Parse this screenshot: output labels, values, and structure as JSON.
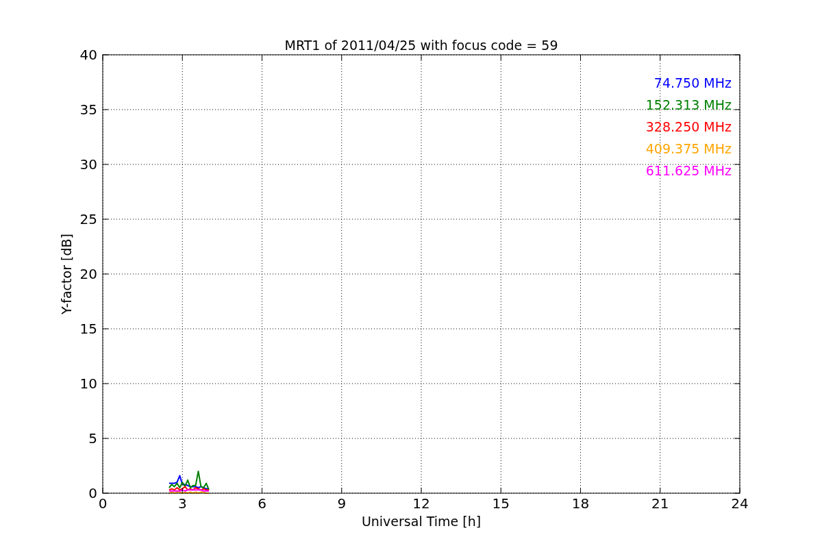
{
  "chart_data": {
    "type": "line",
    "title": "MRT1 of 2011/04/25 with focus code = 59",
    "xlabel": "Universal Time [h]",
    "ylabel": "Y-factor [dB]",
    "x": [
      2.5,
      2.6,
      2.7,
      2.8,
      2.9,
      3.0,
      3.1,
      3.2,
      3.3,
      3.4,
      3.5,
      3.6,
      3.7,
      3.8,
      3.9,
      4.0
    ],
    "series": [
      {
        "name": "74.750 MHz",
        "color": "#0000ff",
        "values": [
          0.9,
          0.9,
          0.9,
          1.0,
          1.6,
          0.8,
          0.8,
          0.7,
          0.6,
          0.6,
          0.6,
          0.5,
          0.6,
          0.5,
          0.4,
          0.4
        ]
      },
      {
        "name": "152.313 MHz",
        "color": "#008000",
        "values": [
          0.5,
          0.8,
          0.6,
          0.9,
          0.5,
          1.0,
          0.6,
          1.2,
          0.5,
          0.7,
          0.7,
          2.0,
          0.6,
          0.5,
          0.9,
          0.3
        ]
      },
      {
        "name": "328.250 MHz",
        "color": "#ff0000",
        "values": [
          0.3,
          0.4,
          0.3,
          0.5,
          0.3,
          0.4,
          0.6,
          0.3,
          0.4,
          0.3,
          0.5,
          0.4,
          0.3,
          0.4,
          0.3,
          0.3
        ]
      },
      {
        "name": "409.375 MHz",
        "color": "#ffa500",
        "values": [
          0.0,
          0.1,
          0.0,
          0.1,
          0.1,
          0.0,
          0.1,
          0.0,
          0.1,
          0.0,
          0.1,
          0.0,
          0.1,
          0.1,
          0.0,
          0.0
        ]
      },
      {
        "name": "611.625 MHz",
        "color": "#ff00ff",
        "values": [
          0.2,
          0.2,
          0.2,
          0.2,
          0.2,
          0.3,
          0.2,
          0.3,
          0.3,
          0.3,
          0.3,
          0.3,
          0.3,
          0.2,
          0.2,
          0.2
        ]
      }
    ],
    "xlim": [
      0,
      24
    ],
    "ylim": [
      0,
      40
    ],
    "xticks": [
      0,
      3,
      6,
      9,
      12,
      15,
      18,
      21,
      24
    ],
    "yticks": [
      0,
      5,
      10,
      15,
      20,
      25,
      30,
      35,
      40
    ],
    "grid": true
  }
}
